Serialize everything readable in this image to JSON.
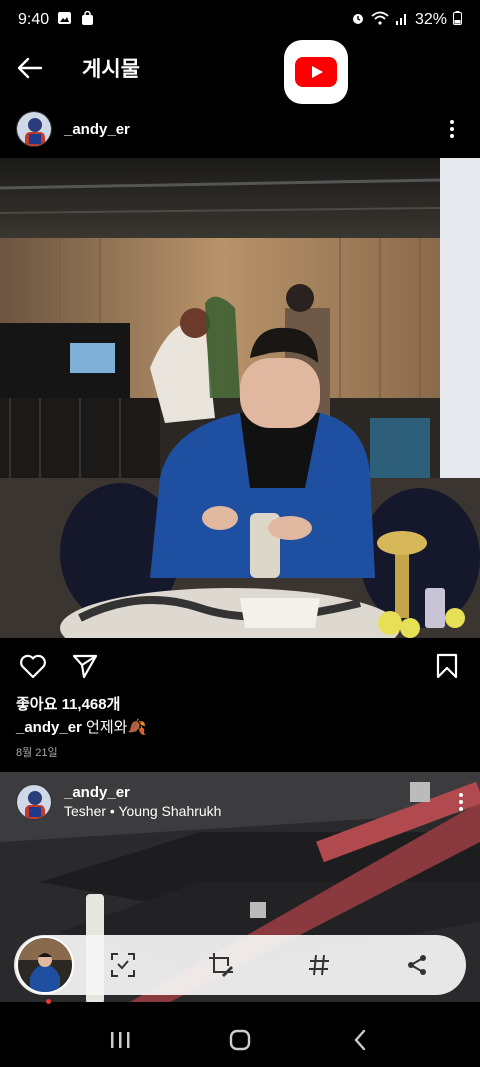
{
  "status_bar": {
    "time": "9:40",
    "battery_percent": "32%"
  },
  "header": {
    "title": "게시물"
  },
  "post": {
    "username": "_andy_er",
    "likes_text": "좋아요 11,468개",
    "caption_user": "_andy_er",
    "caption_text": " 언제와🍂",
    "date": "8월 21일"
  },
  "next_post": {
    "username": "_andy_er",
    "music": "Tesher • Young Shahrukh"
  },
  "icons": {
    "back": "arrow-left",
    "youtube": "youtube-logo",
    "more": "more-vertical",
    "like": "heart",
    "share": "send",
    "save": "bookmark",
    "scan": "scan-text",
    "crop_edit": "crop-edit",
    "hashtag": "hashtag",
    "share_alt": "share-nodes"
  },
  "colors": {
    "background": "#000000",
    "youtube_red": "#ff0000",
    "pill_bg": "#f5f5f5",
    "date_gray": "#a8a8a8"
  }
}
